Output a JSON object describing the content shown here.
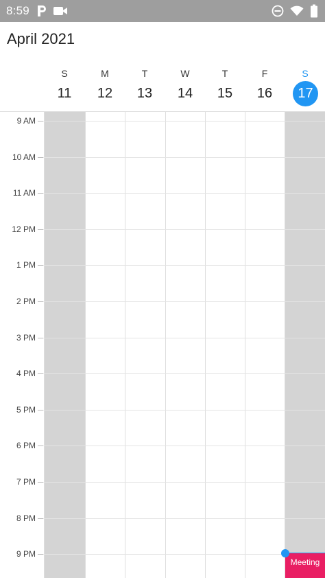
{
  "status_bar": {
    "time": "8:59",
    "left_icons": [
      "parking-app-icon",
      "video-camera-icon"
    ],
    "right_icons": [
      "do-not-disturb-icon",
      "wifi-icon",
      "battery-icon"
    ]
  },
  "calendar": {
    "month_title": "April 2021",
    "days": [
      {
        "letter": "S",
        "number": "11",
        "weekend": true,
        "today": false
      },
      {
        "letter": "M",
        "number": "12",
        "weekend": false,
        "today": false
      },
      {
        "letter": "T",
        "number": "13",
        "weekend": false,
        "today": false
      },
      {
        "letter": "W",
        "number": "14",
        "weekend": false,
        "today": false
      },
      {
        "letter": "T",
        "number": "15",
        "weekend": false,
        "today": false
      },
      {
        "letter": "F",
        "number": "16",
        "weekend": false,
        "today": false
      },
      {
        "letter": "S",
        "number": "17",
        "weekend": true,
        "today": true
      }
    ],
    "hours": [
      "9 AM",
      "10 AM",
      "11 AM",
      "12 PM",
      "1 PM",
      "2 PM",
      "3 PM",
      "4 PM",
      "5 PM",
      "6 PM",
      "7 PM",
      "8 PM",
      "9 PM"
    ],
    "event": {
      "title": "Meeting",
      "color": "#e91e63"
    },
    "colors": {
      "accent": "#2196f3",
      "weekend_shade": "#d4d4d4",
      "status_bar": "#9e9e9e"
    }
  }
}
